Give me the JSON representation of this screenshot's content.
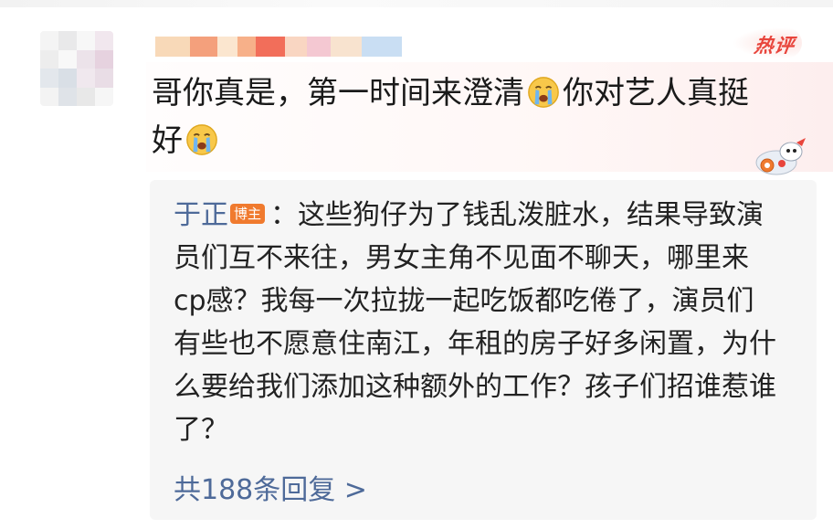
{
  "comment": {
    "author_blurred": true,
    "text_line1": "哥你真是，第一时间来澄清",
    "text_line1b": "你对艺人真挺",
    "text_line2": "好",
    "emoji": "crying-face"
  },
  "hot_badge": "热评",
  "reply": {
    "username": "于正",
    "badge": "博主",
    "separator": "：",
    "text": "这些狗仔为了钱乱泼脏水，结果导致演员们互不来往，男女主角不见面不聊天，哪里来cp感？我每一次拉拢一起吃饭都吃倦了，演员们有些也不愿意住南江，年租的房子好多闲置，为什么要给我们添加这种额外的工作？孩子们招谁惹谁了？"
  },
  "more_replies": "共188条回复 >",
  "colors": {
    "link_blue": "#4e6a99",
    "hot_red": "#e8453c",
    "blogger_orange": "#f07a2e",
    "reply_bg": "#f6f6f6"
  }
}
